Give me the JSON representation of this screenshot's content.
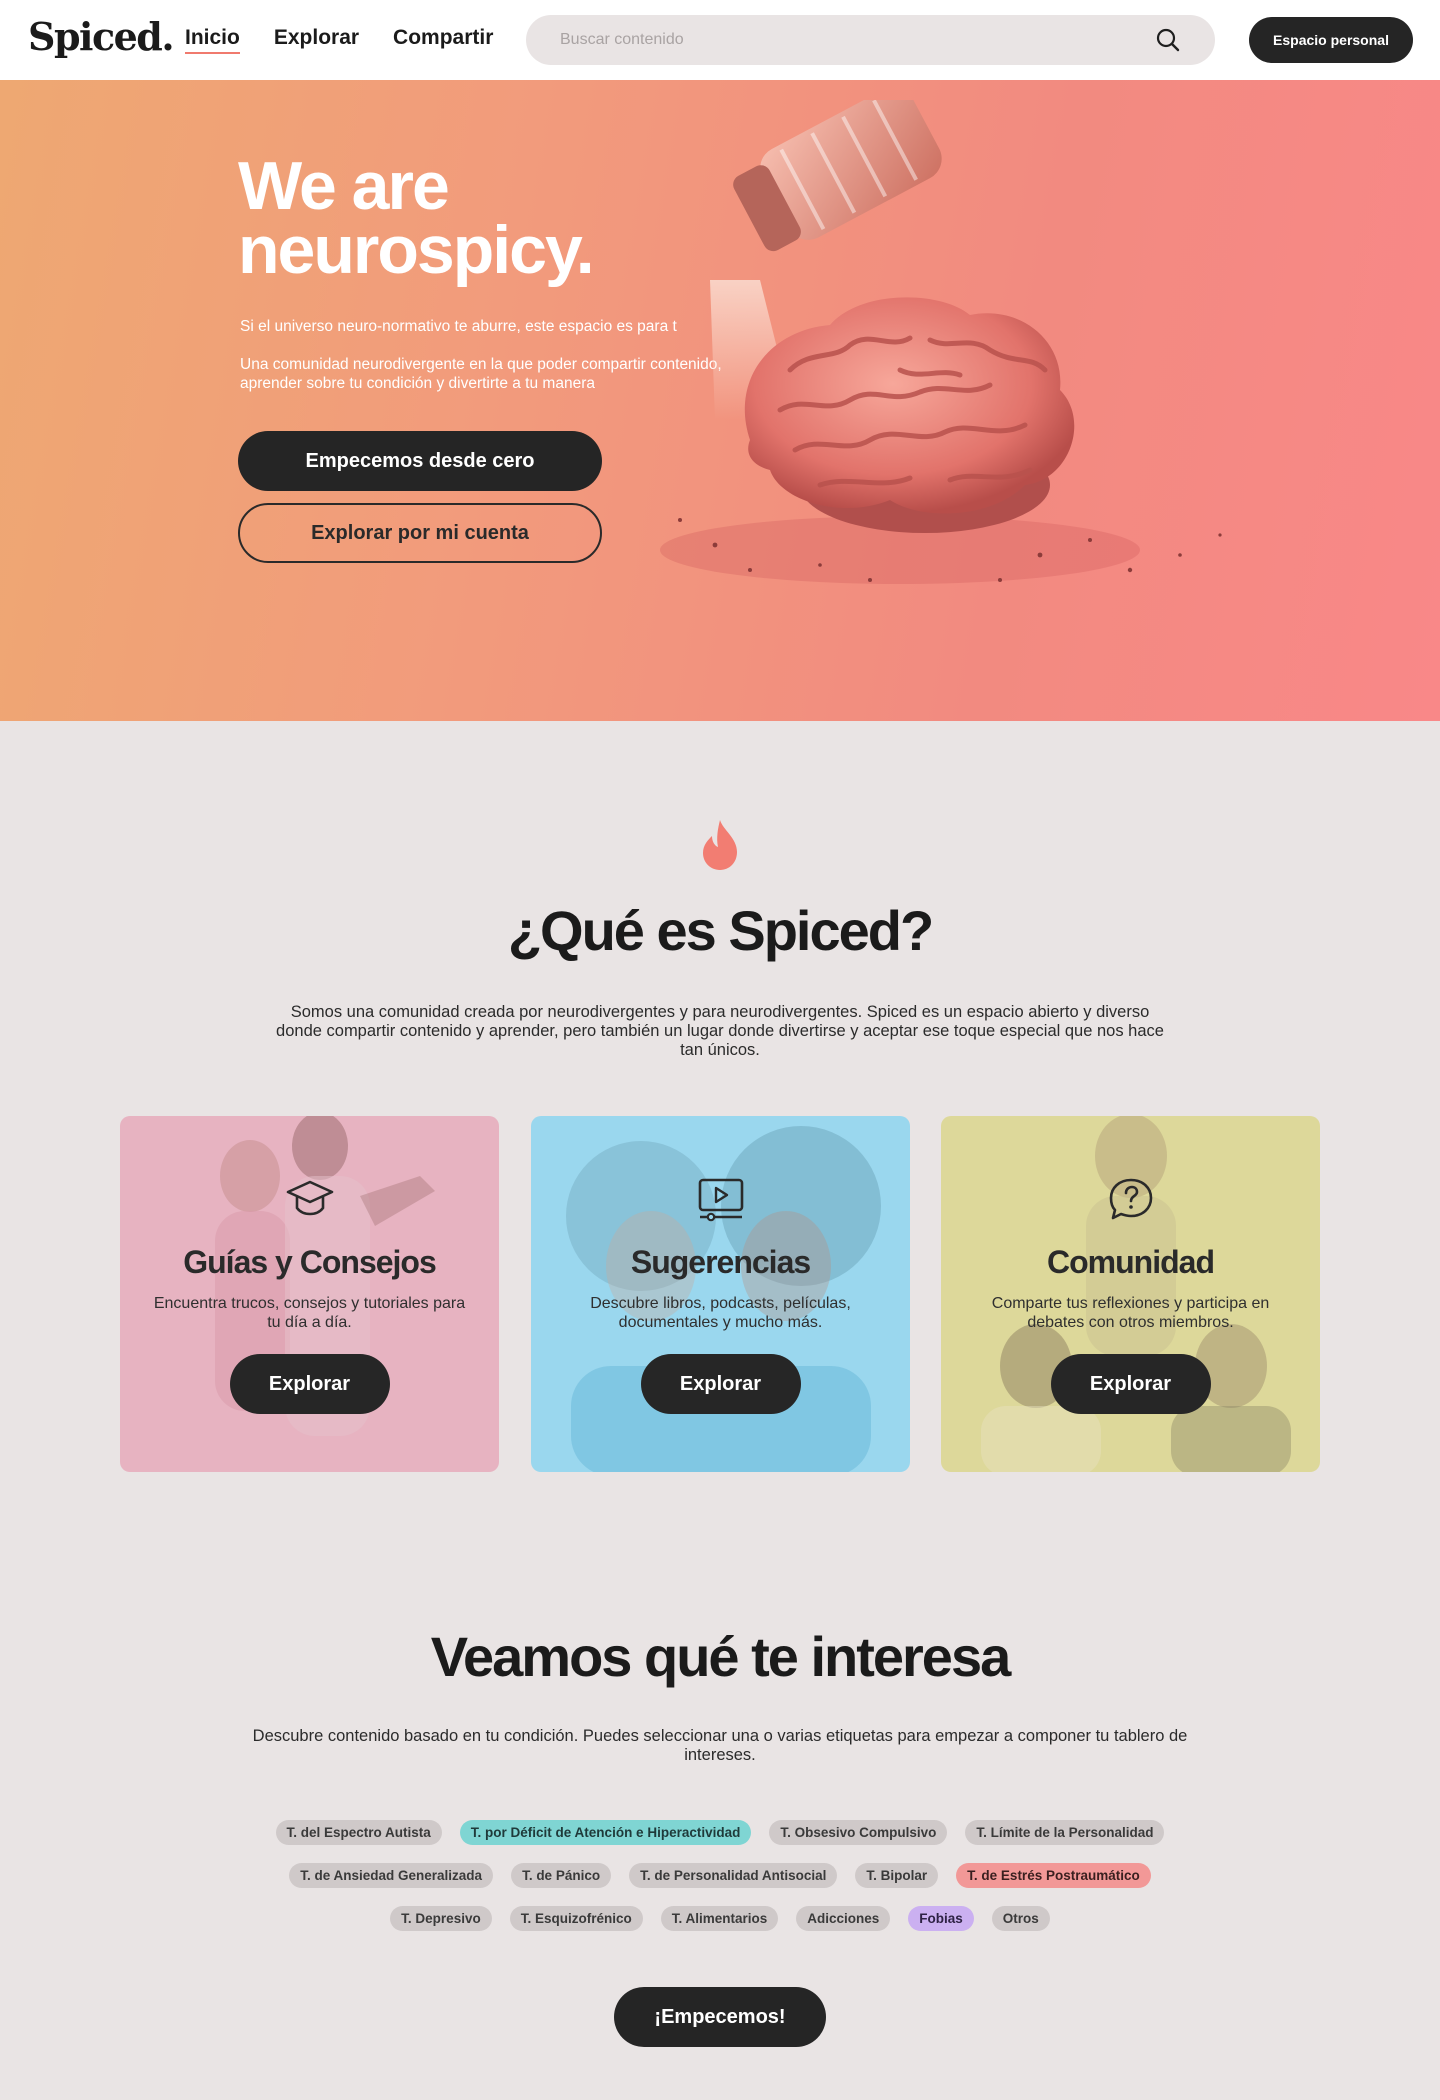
{
  "header": {
    "logo": "Spiced.",
    "nav": [
      "Inicio",
      "Explorar",
      "Compartir"
    ],
    "search_placeholder": "Buscar contenido",
    "personal_button": "Espacio personal",
    "icons": {
      "search": "search-icon"
    },
    "accent_color": "#f07a6e"
  },
  "hero": {
    "title": "We are neurospicy.",
    "subtitle": "Si el universo neuro-normativo te aburre, este espacio es para t",
    "description": "Una comunidad neurodivergente en la que poder compartir contenido, aprender sobre tu condición y divertirte a tu manera",
    "primary_button": "Empecemos desde cero",
    "secondary_button": "Explorar por mi cuenta",
    "illustration": "salt-shaker-brain-illustration"
  },
  "about": {
    "icon": "flame-icon",
    "title": "¿Qué es Spiced?",
    "description": "Somos una comunidad creada por neurodivergentes y para neurodivergentes. Spiced es un espacio abierto y diverso donde compartir contenido y aprender, pero también un lugar donde divertirse y aceptar ese toque especial que nos hace tan únicos.",
    "cards": [
      {
        "icon": "graduation-cap-icon",
        "title": "Guías y Consejos",
        "text": "Encuentra trucos, consejos y tutoriales para tu día a día.",
        "button": "Explorar",
        "color": "#e7b3c1"
      },
      {
        "icon": "video-player-icon",
        "title": "Sugerencias",
        "text": "Descubre libros, podcasts, películas, documentales y mucho más.",
        "button": "Explorar",
        "color": "#9ad7ee"
      },
      {
        "icon": "question-bubble-icon",
        "title": "Comunidad",
        "text": "Comparte tus reflexiones y participa en debates con otros miembros.",
        "button": "Explorar",
        "color": "#ddd89a"
      }
    ]
  },
  "interests": {
    "title": "Veamos qué te interesa",
    "description": "Descubre contenido basado en tu condición. Puedes seleccionar una o varias etiquetas para empezar a componer tu tablero de intereses.",
    "tag_rows": [
      [
        "T. del Espectro Autista",
        "T. por Déficit de Atención e Hiperactividad",
        "T. Obsesivo Compulsivo",
        "T. Límite de la Personalidad"
      ],
      [
        "T. de Ansiedad Generalizada",
        "T. de Pánico",
        "T. de Personalidad Antisocial",
        "T. Bipolar",
        "T. de Estrés Postraumático"
      ],
      [
        "T. Depresivo",
        "T. Esquizofrénico",
        "T. Alimentarios",
        "Adicciones",
        "Fobias",
        "Otros"
      ]
    ],
    "selected_tags": {
      "T. por Déficit de Atención e Hiperactividad": "#7fd5d3",
      "T. de Estrés Postraumático": "#f29897",
      "Fobias": "#cbb0f1"
    },
    "start_button": "¡Empecemos!"
  }
}
